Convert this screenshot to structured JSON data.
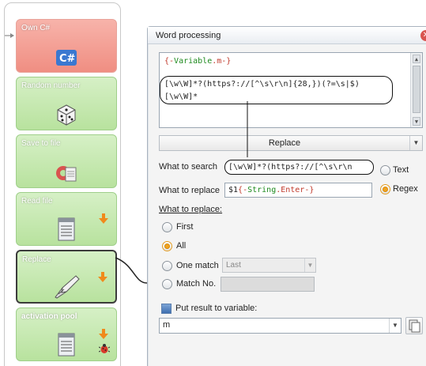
{
  "flow": {
    "blocks": [
      {
        "title": "Own C#",
        "icon": "csharp-icon"
      },
      {
        "title": "Random number",
        "icon": "dice-icon"
      },
      {
        "title": "Save to file",
        "icon": "save-file-icon"
      },
      {
        "title": "Read file",
        "icon": "document-icon"
      },
      {
        "title": "Replace",
        "icon": "pen-nib-icon"
      },
      {
        "title": "activation pool",
        "icon": "document-icon"
      }
    ]
  },
  "dialog": {
    "title": "Word processing",
    "close_glyph": "✕",
    "editor": {
      "line1_open": "{-",
      "line1_var": "Variable",
      "line1_close": ".m-}",
      "line2": "[\\w\\W]*?(https?://[^\\s\\r\\n]{28,})(?=\\s|$)",
      "line3": "[\\w\\W]*"
    },
    "action": "Replace",
    "search_label": "What to search",
    "search_value": "[\\w\\W]*?(https?://[^\\s\\r\\n",
    "replace_label": "What to replace",
    "replace_prefix": "$1",
    "replace_token_open": "{-",
    "replace_var": "String",
    "replace_token_close": ".Enter-}",
    "mode_text": "Text",
    "mode_regex": "Regex",
    "what_to_replace_label": "What to replace:",
    "option_first": "First",
    "option_all": "All",
    "option_one_match": "One match",
    "one_match_value": "Last",
    "option_match_no": "Match No.",
    "put_result_label": "Put result to variable:",
    "result_variable": "m"
  },
  "colors": {
    "green_block": "#b8e29e",
    "red_block": "#f08e82",
    "radio_selected": "#f0a322",
    "variable_token": "#1e8a1e",
    "brace_token": "#c0392b"
  }
}
